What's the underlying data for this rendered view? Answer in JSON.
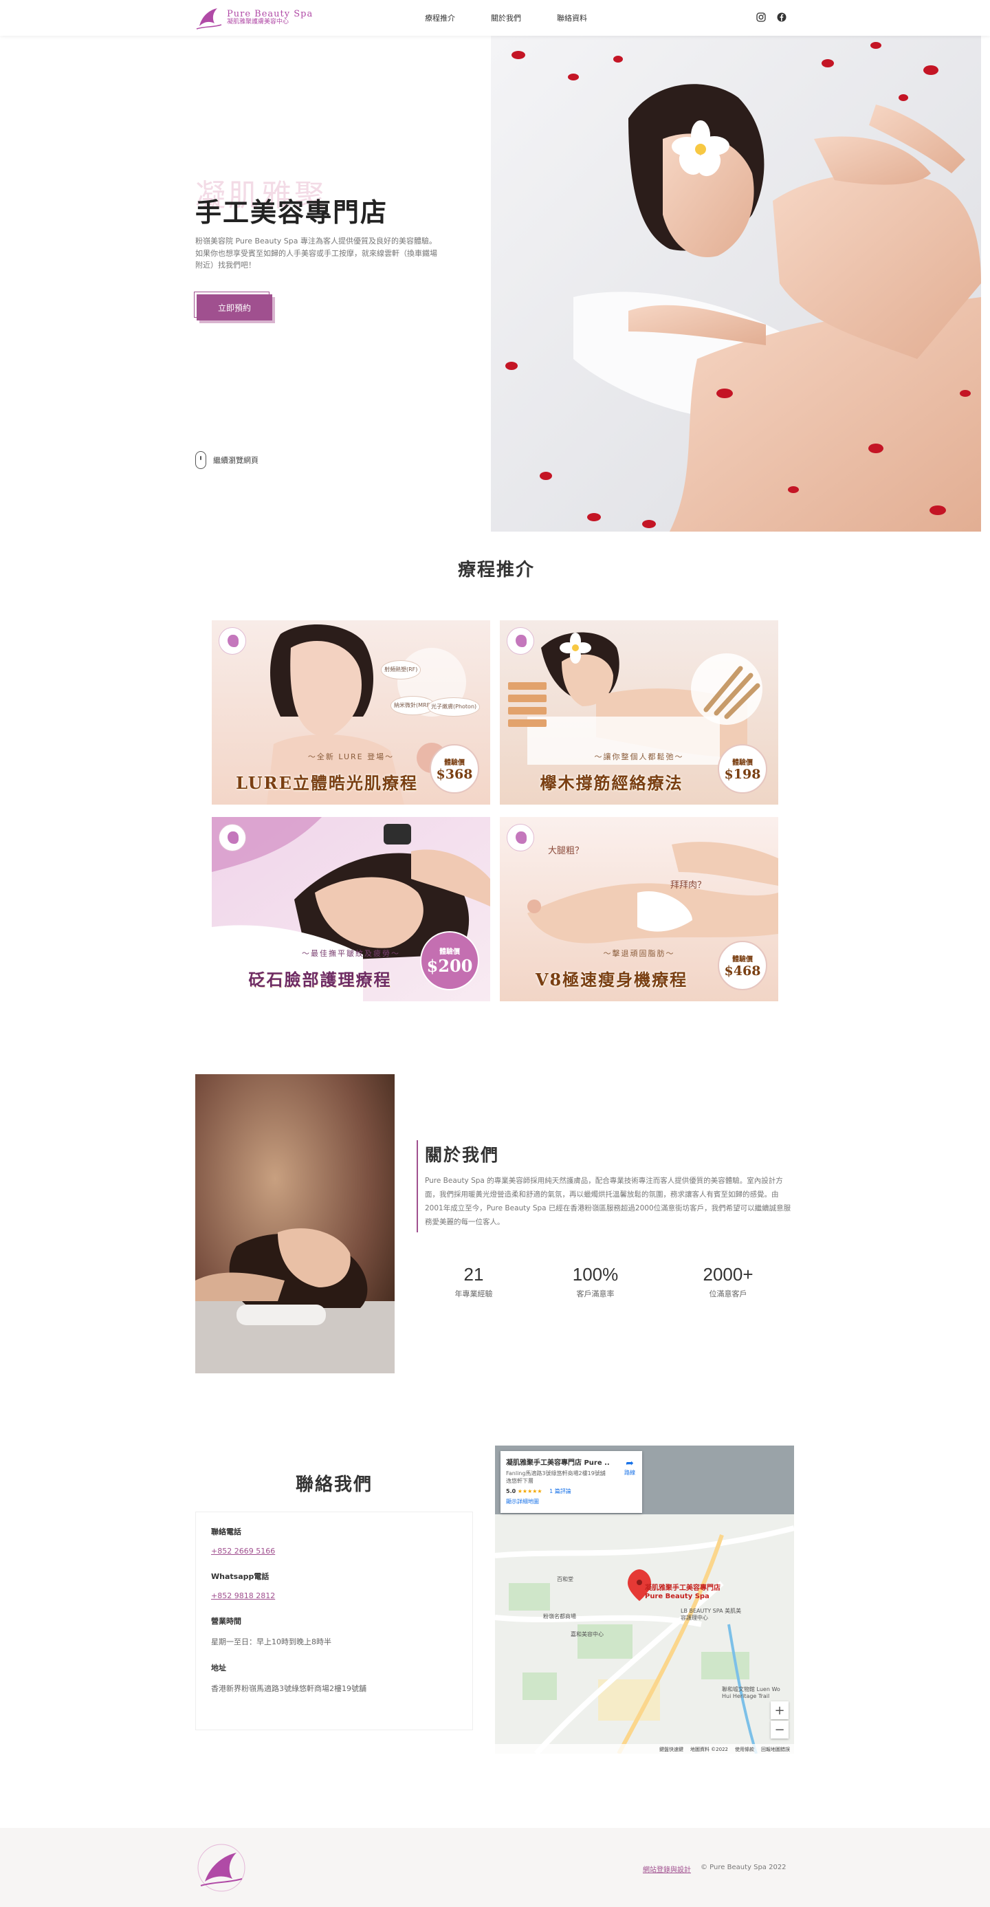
{
  "header": {
    "logo_en": "Pure Beauty Spa",
    "logo_zh": "凝肌雅聚護膚美容中心",
    "nav": [
      "療程推介",
      "關於我們",
      "聯絡資料"
    ],
    "social_icons": [
      "instagram-icon",
      "facebook-icon"
    ]
  },
  "hero": {
    "ghost_title": "凝肌雅聚",
    "title": "手工美容專門店",
    "description": "粉嶺美容院 Pure Beauty Spa 專注為客人提供優質及良好的美容體驗。如果你也想享受賓至如歸的人手美容或手工按摩，就來線雲軒（換車鐵場附近）找我們吧！",
    "button": "立即預約",
    "scroll_hint": "繼續瀏覽網頁"
  },
  "services": {
    "title": "療程推介",
    "cards": [
      {
        "subtitle": "～全新 LURE 登場～",
        "title": "LURE立體晧光肌療程",
        "badge_label": "體驗價",
        "price": "$368"
      },
      {
        "subtitle": "～讓你整個人都鬆弛～",
        "title": "欅木撐筋經絡療法",
        "badge_label": "體驗價",
        "price": "$198"
      },
      {
        "subtitle": "～最佳撫平皺紋及疲勞～",
        "title": "砭石臉部護理療程",
        "badge_label": "體驗價",
        "price": "$200"
      },
      {
        "subtitle": "～擊退頑固脂肪～",
        "title": "V8極速瘦身機療程",
        "badge_label": "體驗價",
        "price": "$468"
      }
    ],
    "card1_tags": [
      "射頻熱塑(RF)",
      "納米微針(MRF)",
      "光子嫩膚(Photon)"
    ],
    "card4_tags": [
      "大腿粗？",
      "拜拜肉？"
    ]
  },
  "about": {
    "title": "關於我們",
    "text": "Pure Beauty Spa 的專業美容師採用純天然護膚品，配合專業技術專注而客人提供優質的美容體驗。室內設計方面，我們採用暖黃光燈營造柔和舒適的氣氛，再以蠟燭烘托溫馨放鬆的氛圍，務求讓客人有賓至如歸的感覺。由2001年成立至今，Pure Beauty Spa 已經在香港粉嶺區服務超過2000位滿意街坊客戶，我們希望可以繼續誠意服務愛美麗的每一位客人。",
    "stats": [
      {
        "num": "21",
        "label": "年專業經驗"
      },
      {
        "num": "100%",
        "label": "客戶滿意率"
      },
      {
        "num": "2000+",
        "label": "位滿意客戶"
      }
    ]
  },
  "contact": {
    "title": "聯絡我們",
    "phone_label": "聯絡電話",
    "phone": "+852 2669 5166",
    "whatsapp_label": "Whatsapp電話",
    "whatsapp": "+852 9818 2812",
    "hours_label": "營業時間",
    "hours": "星期一至日：早上10時到晚上8時半",
    "address_label": "地址",
    "address": "香港新界粉嶺馬適路3號綠悠軒商場2樓19號舖"
  },
  "map": {
    "place_title": "凝肌雅聚手工美容專門店 Pure ...",
    "place_address": "Fanling馬適路3號綠悠軒商場2樓19號舖逸悠軒下層",
    "rating": "5.0",
    "stars": "★★★★★",
    "reviews": "1 篇評論",
    "larger_map": "顯示詳細地圖",
    "directions": "路線",
    "pin_label": "凝肌雅聚手工美容專門店Pure Beauty Spa",
    "labels": [
      "LB BEAUTY SPA 美肌美容護理中心",
      "粉嶺名都商場",
      "百和堂",
      "嘉和美容中心",
      "聯和墟文物館 Luen Wo Hui Heritage Trail"
    ],
    "zoom_in": "+",
    "zoom_out": "−",
    "footer": [
      "鍵盤快速鍵",
      "地圖資料 ©2022",
      "使用條款",
      "回報地圖錯誤"
    ]
  },
  "footer": {
    "design_link": "網站登錄與設計",
    "copyright": "© Pure Beauty Spa 2022"
  },
  "colors": {
    "accent": "#a0508f",
    "brand": "#b04aa6",
    "footer_bg": "#f7f5f4"
  }
}
